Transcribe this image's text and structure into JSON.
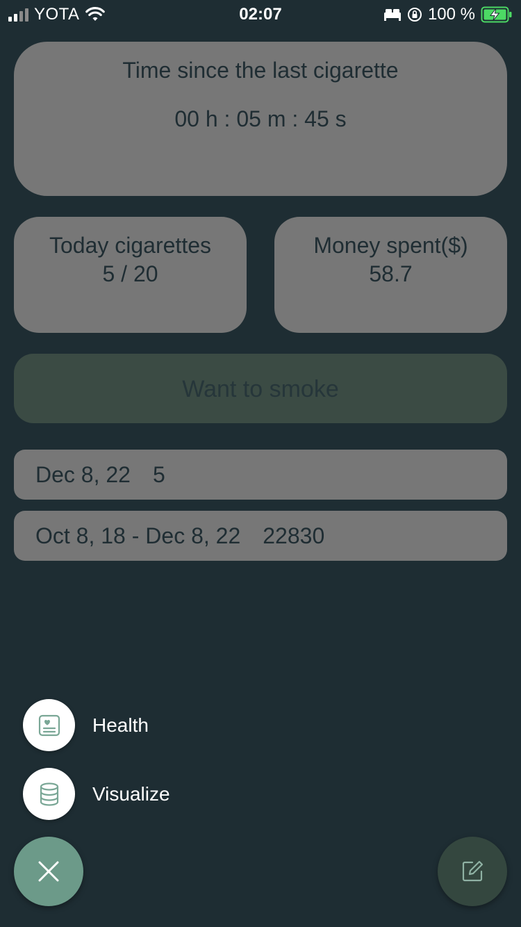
{
  "status_bar": {
    "carrier": "YOTA",
    "time": "02:07",
    "battery_percent": "100 %"
  },
  "timer_card": {
    "title": "Time since the last cigarette",
    "value": "00 h : 05 m : 45 s"
  },
  "today_card": {
    "label": "Today cigarettes",
    "value": "5 / 20"
  },
  "money_card": {
    "label": "Money spent($)",
    "value": "58.7"
  },
  "smoke_button": {
    "label": "Want to smoke"
  },
  "history": [
    {
      "date": "Dec 8, 22",
      "count": "5"
    },
    {
      "date": "Oct 8, 18 - Dec 8, 22",
      "count": "22830"
    }
  ],
  "fab_menu": {
    "items": [
      {
        "label": "Health",
        "icon": "health-card-icon"
      },
      {
        "label": "Visualize",
        "icon": "database-icon"
      }
    ],
    "close_icon": "close-icon",
    "edit_icon": "edit-icon"
  },
  "colors": {
    "background": "#1e2d33",
    "card": "#777777",
    "smoke_button": "#3b4b44",
    "accent": "#6c9a89",
    "edit_fab": "#34473f"
  }
}
